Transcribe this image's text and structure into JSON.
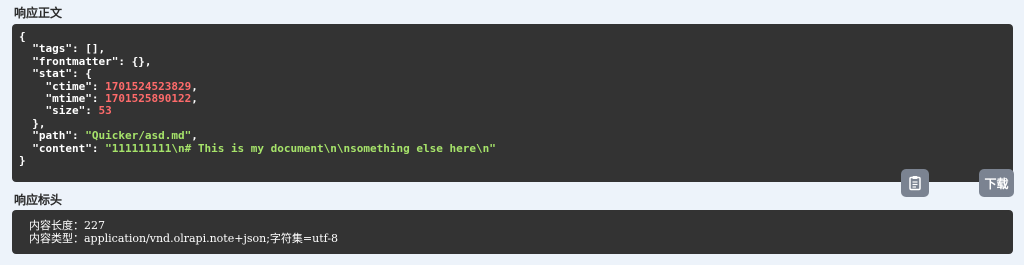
{
  "sections": {
    "response_body_title": "响应正文",
    "response_headers_title": "响应标头"
  },
  "response_body": {
    "open_brace": "{",
    "tags_key": "\"tags\"",
    "tags_value": "[],",
    "frontmatter_key": "\"frontmatter\"",
    "frontmatter_value": "{},",
    "stat_key": "\"stat\"",
    "stat_open": "{",
    "ctime_key": "\"ctime\"",
    "ctime_value": "1701524523829",
    "mtime_key": "\"mtime\"",
    "mtime_value": "1701525890122",
    "size_key": "\"size\"",
    "size_value": "53",
    "stat_close": "},",
    "path_key": "\"path\"",
    "path_value": "\"Quicker/asd.md\"",
    "content_key": "\"content\"",
    "content_value": "\"111111111\\n# This is my document\\n\\nsomething else here\\n\"",
    "close_brace": "}"
  },
  "buttons": {
    "copy_icon": "clipboard-icon",
    "download_label": "下载"
  },
  "response_headers": {
    "content_length": "内容长度：227",
    "content_type": "内容类型：application/vnd.olrapi.note+json;字符集=utf-8"
  }
}
